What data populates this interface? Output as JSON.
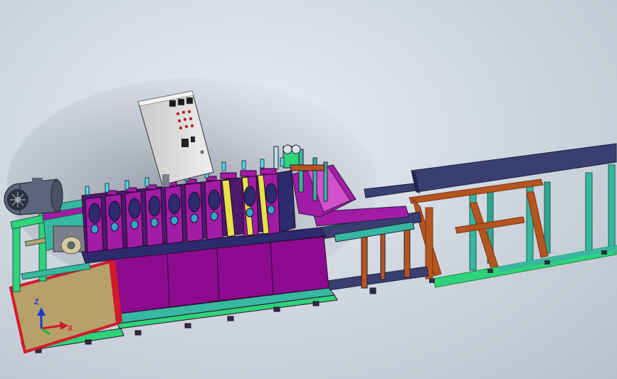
{
  "viewport": {
    "triad": {
      "x_label": "X",
      "z_label": "Z"
    }
  },
  "model": {
    "colors": {
      "frame_green": "#2fd37a",
      "frame_teal": "#37b8a0",
      "frame_brown": "#b5551f",
      "roller_purple": "#a21ca5",
      "panel_magenta": "#8d0b8f",
      "dark_navy": "#2b2b6e",
      "control_box": "#d8d8d8",
      "motor_grey": "#5b6478",
      "base_tan": "#b8a06a",
      "red_edge": "#d11a2a"
    }
  }
}
